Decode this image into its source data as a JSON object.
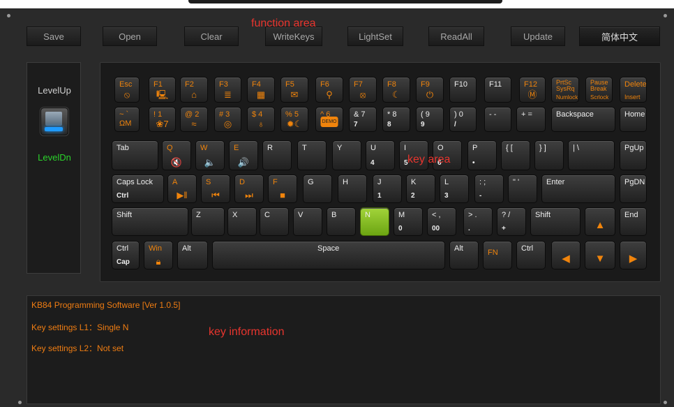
{
  "top_text": "function area",
  "toolbar": {
    "save": "Save",
    "open": "Open",
    "clear": "Clear",
    "writekeys": "WriteKeys",
    "lightset": "LightSet",
    "readall": "ReadAll",
    "update": "Update",
    "language": "简体中文"
  },
  "annotations": {
    "function_area": "function area",
    "key_area": "key area",
    "key_information": "key information"
  },
  "level": {
    "up": "LevelUp",
    "down": "LevelDn"
  },
  "keys": {
    "esc": "Esc",
    "f1": "F1",
    "f2": "F2",
    "f3": "F3",
    "f4": "F4",
    "f5": "F5",
    "f6": "F6",
    "f7": "F7",
    "f8": "F8",
    "f9": "F9",
    "f10": "F10",
    "f11": "F11",
    "f12": "F12",
    "prtsc": "PrtSc",
    "sysrq": "SysRq",
    "numlock": "Numlock",
    "pause": "Pause",
    "break": "Break",
    "scrlock": "Scrlock",
    "delete": "Delete",
    "insert": "Insert",
    "tilde": "~  `",
    "k1": "!  1",
    "k2": "@  2",
    "k3": "#  3",
    "k4": "$  4",
    "k5": "%  5",
    "k6": "^  6",
    "k7": "&  7",
    "k7s": "7",
    "k8": "*  8",
    "k8s": "8",
    "k9": "(  9",
    "k9s": "9",
    "k0": ")  0",
    "k0s": "/",
    "minus": "-  -",
    "plus": "+  =",
    "backspace": "Backspace",
    "home": "Home",
    "demo": "DEMO",
    "tab": "Tab",
    "q": "Q",
    "w": "W",
    "e": "E",
    "r": "R",
    "t": "T",
    "y": "Y",
    "u": "U",
    "us": "4",
    "i": "I",
    "is": "5",
    "o": "O",
    "os": "6",
    "p": "P",
    "ps": "•",
    "lbrace": "{  [",
    "rbrace": "}  ]",
    "pipe": "|  \\",
    "pgup": "PgUp",
    "caps": "Caps Lock",
    "caps_s": "Ctrl",
    "a": "A",
    "s": "S",
    "d": "D",
    "f": "F",
    "g": "G",
    "h": "H",
    "j": "J",
    "js": "1",
    "k": "K",
    "ks": "2",
    "l": "L",
    "ls": "3",
    "semi": ":  ;",
    "semis": "-",
    "quote": "\"  '",
    "enter": "Enter",
    "pgdn": "PgDN",
    "lshift": "Shift",
    "z": "Z",
    "x": "X",
    "c": "C",
    "v": "V",
    "b": "B",
    "n": "N",
    "m": "M",
    "ms": "0",
    "comma": "<  ,",
    "commas": "00",
    "period": ">  .",
    "periods": ".",
    "slash": "?  /",
    "slashs": "+",
    "rshift": "Shift",
    "end": "End",
    "lctrl": "Ctrl",
    "lctrl_s": "Cap",
    "win": "Win",
    "lalt": "Alt",
    "space": "Space",
    "ralt": "Alt",
    "fnk": "FN",
    "rctrl": "Ctrl"
  },
  "info": {
    "title": "KB84 Programming Software [Ver 1.0.5]",
    "l1": "Key settings L1：Single N",
    "l2": "Key settings L2：Not set"
  },
  "colors": {
    "accent_orange": "#f0840c",
    "selected_green": "#8cc63f",
    "annotation_red": "#e8352e",
    "level_down_green": "#2bd32b"
  }
}
